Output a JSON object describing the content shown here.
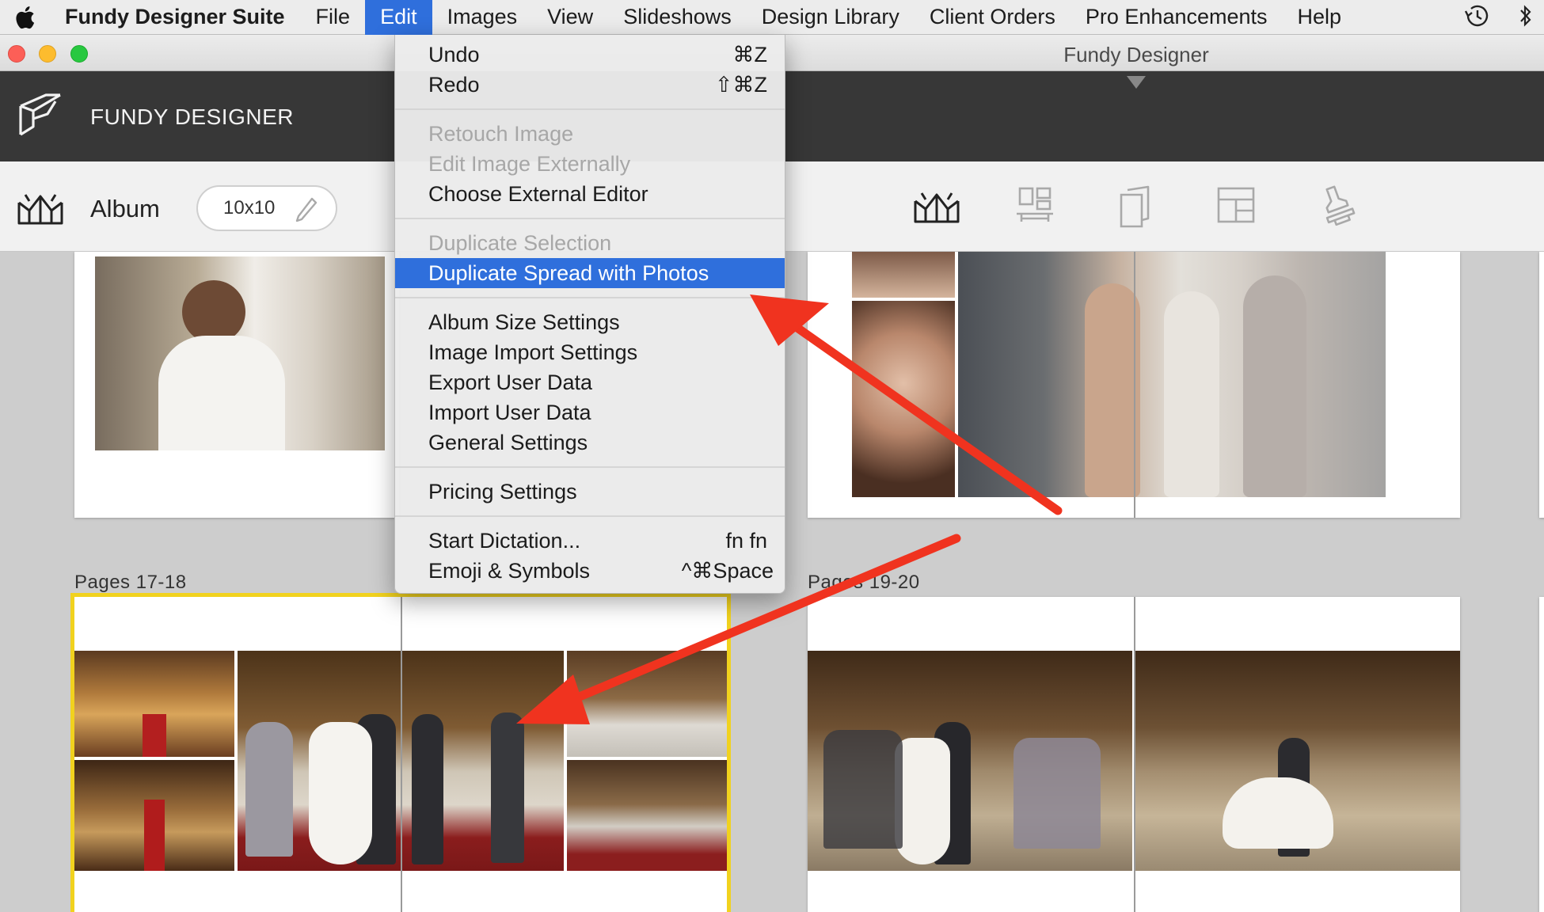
{
  "menubar": {
    "app_name": "Fundy Designer Suite",
    "items": [
      "File",
      "Edit",
      "Images",
      "View",
      "Slideshows",
      "Design Library",
      "Client Orders",
      "Pro Enhancements",
      "Help"
    ],
    "active_item": "Edit"
  },
  "window": {
    "title": "Fundy Designer"
  },
  "header": {
    "brand": "FUNDY DESIGNER"
  },
  "toolbar": {
    "album_label": "Album",
    "size_value": "10x10"
  },
  "edit_menu": {
    "undo": {
      "label": "Undo",
      "shortcut": "⌘Z"
    },
    "redo": {
      "label": "Redo",
      "shortcut": "⇧⌘Z"
    },
    "retouch_image": "Retouch Image",
    "edit_image_externally": "Edit Image Externally",
    "choose_external_editor": "Choose External Editor",
    "duplicate_selection": "Duplicate Selection",
    "duplicate_spread_with_photos": "Duplicate Spread with Photos",
    "album_size_settings": "Album Size Settings",
    "image_import_settings": "Image Import Settings",
    "export_user_data": "Export User Data",
    "import_user_data": "Import User Data",
    "general_settings": "General Settings",
    "pricing_settings": "Pricing Settings",
    "start_dictation": {
      "label": "Start Dictation...",
      "shortcut": "fn fn"
    },
    "emoji_symbols": {
      "label": "Emoji & Symbols",
      "shortcut": "^⌘Space"
    }
  },
  "spreads": {
    "pages_17_18": "Pages 17-18",
    "pages_19_20": "Pages 19-20"
  },
  "colors": {
    "menu_highlight": "#2f6fdc",
    "selection_outline": "#f1d21e",
    "annotation_arrow": "#f0331f"
  }
}
